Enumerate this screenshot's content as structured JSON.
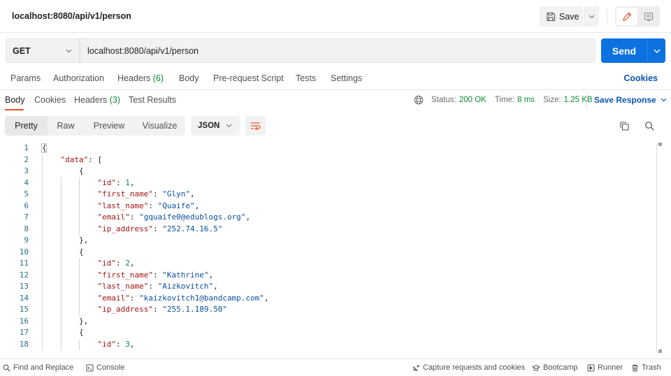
{
  "header": {
    "title": "localhost:8080/api/v1/person",
    "save_label": "Save"
  },
  "request": {
    "method": "GET",
    "url": "localhost:8080/api/v1/person",
    "send_label": "Send"
  },
  "request_tabs": [
    {
      "label": "Params"
    },
    {
      "label": "Authorization"
    },
    {
      "label": "Headers",
      "count": "(6)"
    },
    {
      "label": "Body"
    },
    {
      "label": "Pre-request Script"
    },
    {
      "label": "Tests"
    },
    {
      "label": "Settings"
    }
  ],
  "cookies_link": "Cookies",
  "response_tabs": [
    {
      "label": "Body",
      "active": true
    },
    {
      "label": "Cookies"
    },
    {
      "label": "Headers",
      "count": "(3)"
    },
    {
      "label": "Test Results"
    }
  ],
  "status": {
    "status_label": "Status:",
    "status_value": "200 OK",
    "time_label": "Time:",
    "time_value": "8 ms",
    "size_label": "Size:",
    "size_value": "1.25 KB",
    "save_response_label": "Save Response"
  },
  "view": {
    "modes": [
      "Pretty",
      "Raw",
      "Preview",
      "Visualize"
    ],
    "active_mode": "Pretty",
    "format": "JSON"
  },
  "editor": {
    "lines": [
      {
        "n": "1",
        "indent": 0,
        "tokens": [
          [
            "p",
            "{"
          ]
        ]
      },
      {
        "n": "2",
        "indent": 1,
        "tokens": [
          [
            "k",
            "\"data\""
          ],
          [
            "p",
            ": ["
          ]
        ]
      },
      {
        "n": "3",
        "indent": 2,
        "tokens": [
          [
            "p",
            "{"
          ]
        ]
      },
      {
        "n": "4",
        "indent": 3,
        "tokens": [
          [
            "k",
            "\"id\""
          ],
          [
            "p",
            ": "
          ],
          [
            "n",
            "1"
          ],
          [
            "p",
            ","
          ]
        ]
      },
      {
        "n": "5",
        "indent": 3,
        "tokens": [
          [
            "k",
            "\"first_name\""
          ],
          [
            "p",
            ": "
          ],
          [
            "s",
            "\"Glyn\""
          ],
          [
            "p",
            ","
          ]
        ]
      },
      {
        "n": "6",
        "indent": 3,
        "tokens": [
          [
            "k",
            "\"last_name\""
          ],
          [
            "p",
            ": "
          ],
          [
            "s",
            "\"Quaife\""
          ],
          [
            "p",
            ","
          ]
        ]
      },
      {
        "n": "7",
        "indent": 3,
        "tokens": [
          [
            "k",
            "\"email\""
          ],
          [
            "p",
            ": "
          ],
          [
            "s",
            "\"gquaife0@edublogs.org\""
          ],
          [
            "p",
            ","
          ]
        ]
      },
      {
        "n": "8",
        "indent": 3,
        "tokens": [
          [
            "k",
            "\"ip_address\""
          ],
          [
            "p",
            ": "
          ],
          [
            "s",
            "\"252.74.16.5\""
          ]
        ]
      },
      {
        "n": "9",
        "indent": 2,
        "tokens": [
          [
            "p",
            "},"
          ]
        ]
      },
      {
        "n": "10",
        "indent": 2,
        "tokens": [
          [
            "p",
            "{"
          ]
        ]
      },
      {
        "n": "11",
        "indent": 3,
        "tokens": [
          [
            "k",
            "\"id\""
          ],
          [
            "p",
            ": "
          ],
          [
            "n",
            "2"
          ],
          [
            "p",
            ","
          ]
        ]
      },
      {
        "n": "12",
        "indent": 3,
        "tokens": [
          [
            "k",
            "\"first_name\""
          ],
          [
            "p",
            ": "
          ],
          [
            "s",
            "\"Kathrine\""
          ],
          [
            "p",
            ","
          ]
        ]
      },
      {
        "n": "13",
        "indent": 3,
        "tokens": [
          [
            "k",
            "\"last_name\""
          ],
          [
            "p",
            ": "
          ],
          [
            "s",
            "\"Aizkovitch\""
          ],
          [
            "p",
            ","
          ]
        ]
      },
      {
        "n": "14",
        "indent": 3,
        "tokens": [
          [
            "k",
            "\"email\""
          ],
          [
            "p",
            ": "
          ],
          [
            "s",
            "\"kaizkovitch1@bandcamp.com\""
          ],
          [
            "p",
            ","
          ]
        ]
      },
      {
        "n": "15",
        "indent": 3,
        "tokens": [
          [
            "k",
            "\"ip_address\""
          ],
          [
            "p",
            ": "
          ],
          [
            "s",
            "\"255.1.189.50\""
          ]
        ]
      },
      {
        "n": "16",
        "indent": 2,
        "tokens": [
          [
            "p",
            "},"
          ]
        ]
      },
      {
        "n": "17",
        "indent": 2,
        "tokens": [
          [
            "p",
            "{"
          ]
        ]
      },
      {
        "n": "18",
        "indent": 3,
        "tokens": [
          [
            "k",
            "\"id\""
          ],
          [
            "p",
            ": "
          ],
          [
            "n",
            "3"
          ],
          [
            "p",
            ","
          ]
        ]
      }
    ]
  },
  "footer": {
    "find_replace": "Find and Replace",
    "console": "Console",
    "capture": "Capture requests and cookies",
    "bootcamp": "Bootcamp",
    "runner": "Runner",
    "trash": "Trash"
  },
  "colors": {
    "accent_blue": "#0c72e0",
    "link_blue": "#0a56b3",
    "success_green": "#0f8a39",
    "active_orange": "#e8542c"
  }
}
